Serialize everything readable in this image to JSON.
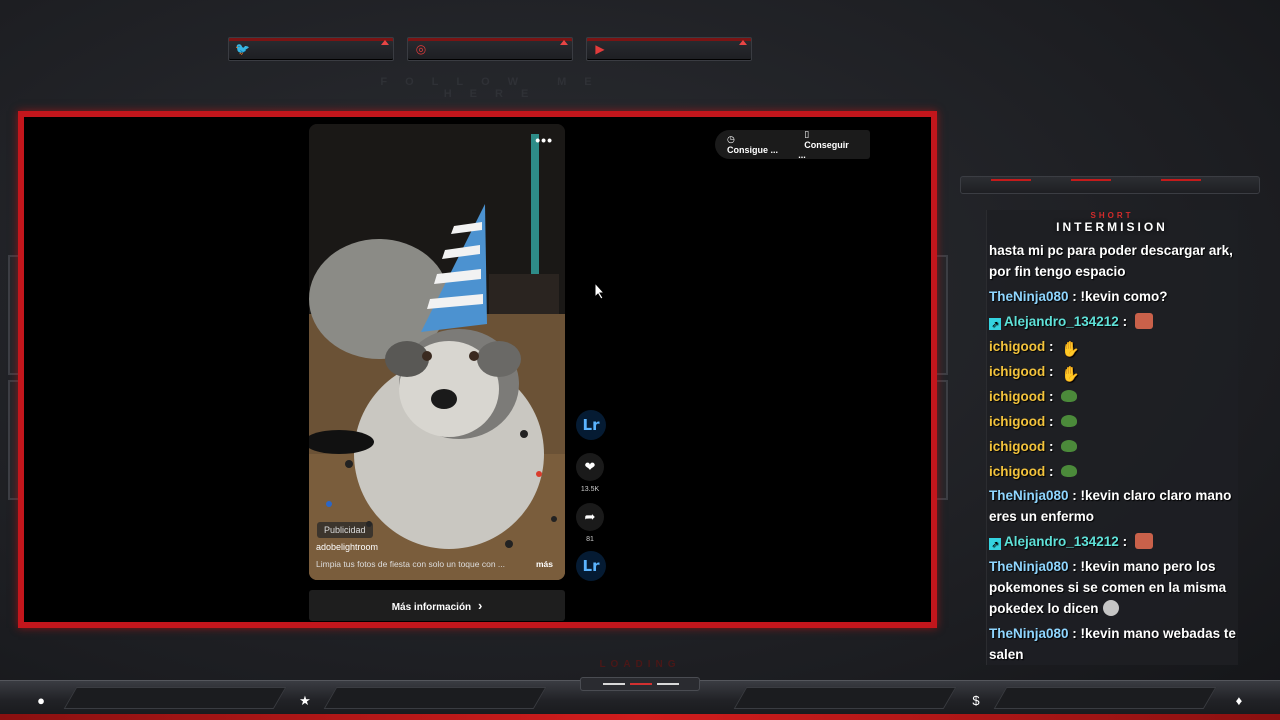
{
  "social": {
    "title": "FOLLOW ME HERE",
    "items": [
      {
        "icon": "twitter-icon",
        "glyph": "🐦"
      },
      {
        "icon": "instagram-icon",
        "glyph": "◎"
      },
      {
        "icon": "youtube-icon",
        "glyph": "▶"
      }
    ]
  },
  "ad": {
    "menu_glyph": "•••",
    "publicidad": "Publicidad",
    "brand": "adobelightroom",
    "caption": "Limpia tus fotos de fiesta con solo un toque con ...",
    "more": "más",
    "cta": "Más información",
    "cta_arrow": "›",
    "logo_text": "Lr",
    "likes": "13.5K",
    "shares": "81",
    "top_actions": [
      "Consigue ...",
      "Conseguir ..."
    ]
  },
  "chat": {
    "tag_small": "SHORT",
    "title": "INTERMISION",
    "messages": [
      {
        "user": "",
        "sep": "",
        "text": "hasta mi pc para poder descargar ark, por fin tengo espacio",
        "color": "yellow"
      },
      {
        "user": "TheNinja080",
        "sep": " : ",
        "text": "!kevin como?",
        "color": "blue"
      },
      {
        "user": "Alejandro_134212",
        "sep": " : ",
        "text": "",
        "color": "teal",
        "badge": true,
        "emote": "face"
      },
      {
        "user": "ichigood",
        "sep": " : ",
        "text": "",
        "color": "yellow",
        "emote": "hand"
      },
      {
        "user": "ichigood",
        "sep": " : ",
        "text": "",
        "color": "yellow",
        "emote": "hand"
      },
      {
        "user": "ichigood",
        "sep": " : ",
        "text": "",
        "color": "yellow",
        "emote": "pepe"
      },
      {
        "user": "ichigood",
        "sep": " : ",
        "text": "",
        "color": "yellow",
        "emote": "pepe"
      },
      {
        "user": "ichigood",
        "sep": " : ",
        "text": "",
        "color": "yellow",
        "emote": "pepe"
      },
      {
        "user": "ichigood",
        "sep": " : ",
        "text": "",
        "color": "yellow",
        "emote": "pepe"
      },
      {
        "user": "TheNinja080",
        "sep": " : ",
        "text": "!kevin claro claro mano eres un enfermo",
        "color": "blue"
      },
      {
        "user": "Alejandro_134212",
        "sep": " : ",
        "text": "",
        "color": "teal",
        "badge": true,
        "emote": "face"
      },
      {
        "user": "TheNinja080",
        "sep": " : ",
        "text": "!kevin mano pero los pokemones si se comen en la misma pokedex lo dicen",
        "color": "blue",
        "emote_after": "wow"
      },
      {
        "user": "TheNinja080",
        "sep": " : ",
        "text": "!kevin mano webadas te salen",
        "color": "blue"
      }
    ]
  },
  "stream": {
    "loading": "LOADING"
  },
  "bottom": {
    "icons": [
      {
        "name": "user-icon",
        "glyph": "●"
      },
      {
        "name": "star-icon",
        "glyph": "★"
      },
      {
        "name": "dollar-icon",
        "glyph": "$"
      },
      {
        "name": "flame-icon",
        "glyph": "♦"
      }
    ]
  },
  "colors": {
    "accent_red": "#c3161c",
    "chat_blue": "#8fd6ff",
    "chat_yellow": "#f3c33c",
    "chat_teal": "#5fe1d8",
    "lr_blue": "#5bb4ff"
  }
}
